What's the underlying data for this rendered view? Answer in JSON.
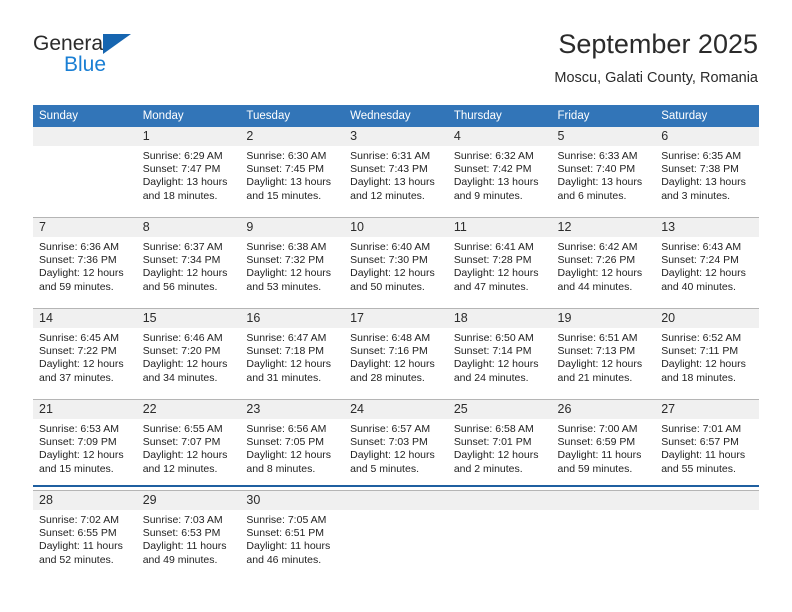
{
  "brand": {
    "name_top": "General",
    "name_bottom": "Blue",
    "accent_dark": "#1665b0",
    "accent_light": "#1a7fd4"
  },
  "header": {
    "title": "September 2025",
    "subtitle": "Moscu, Galati County, Romania"
  },
  "theme": {
    "header_row_bg": "#3275b8",
    "daynum_bg": "#f0f0f0",
    "row_rule": "#b5b5b5",
    "bottom_rule": "#1f5fa0"
  },
  "weekday_headers": [
    "Sunday",
    "Monday",
    "Tuesday",
    "Wednesday",
    "Thursday",
    "Friday",
    "Saturday"
  ],
  "weeks": [
    [
      {
        "day": "",
        "lines": []
      },
      {
        "day": "1",
        "lines": [
          "Sunrise: 6:29 AM",
          "Sunset: 7:47 PM",
          "Daylight: 13 hours",
          "and 18 minutes."
        ]
      },
      {
        "day": "2",
        "lines": [
          "Sunrise: 6:30 AM",
          "Sunset: 7:45 PM",
          "Daylight: 13 hours",
          "and 15 minutes."
        ]
      },
      {
        "day": "3",
        "lines": [
          "Sunrise: 6:31 AM",
          "Sunset: 7:43 PM",
          "Daylight: 13 hours",
          "and 12 minutes."
        ]
      },
      {
        "day": "4",
        "lines": [
          "Sunrise: 6:32 AM",
          "Sunset: 7:42 PM",
          "Daylight: 13 hours",
          "and 9 minutes."
        ]
      },
      {
        "day": "5",
        "lines": [
          "Sunrise: 6:33 AM",
          "Sunset: 7:40 PM",
          "Daylight: 13 hours",
          "and 6 minutes."
        ]
      },
      {
        "day": "6",
        "lines": [
          "Sunrise: 6:35 AM",
          "Sunset: 7:38 PM",
          "Daylight: 13 hours",
          "and 3 minutes."
        ]
      }
    ],
    [
      {
        "day": "7",
        "lines": [
          "Sunrise: 6:36 AM",
          "Sunset: 7:36 PM",
          "Daylight: 12 hours",
          "and 59 minutes."
        ]
      },
      {
        "day": "8",
        "lines": [
          "Sunrise: 6:37 AM",
          "Sunset: 7:34 PM",
          "Daylight: 12 hours",
          "and 56 minutes."
        ]
      },
      {
        "day": "9",
        "lines": [
          "Sunrise: 6:38 AM",
          "Sunset: 7:32 PM",
          "Daylight: 12 hours",
          "and 53 minutes."
        ]
      },
      {
        "day": "10",
        "lines": [
          "Sunrise: 6:40 AM",
          "Sunset: 7:30 PM",
          "Daylight: 12 hours",
          "and 50 minutes."
        ]
      },
      {
        "day": "11",
        "lines": [
          "Sunrise: 6:41 AM",
          "Sunset: 7:28 PM",
          "Daylight: 12 hours",
          "and 47 minutes."
        ]
      },
      {
        "day": "12",
        "lines": [
          "Sunrise: 6:42 AM",
          "Sunset: 7:26 PM",
          "Daylight: 12 hours",
          "and 44 minutes."
        ]
      },
      {
        "day": "13",
        "lines": [
          "Sunrise: 6:43 AM",
          "Sunset: 7:24 PM",
          "Daylight: 12 hours",
          "and 40 minutes."
        ]
      }
    ],
    [
      {
        "day": "14",
        "lines": [
          "Sunrise: 6:45 AM",
          "Sunset: 7:22 PM",
          "Daylight: 12 hours",
          "and 37 minutes."
        ]
      },
      {
        "day": "15",
        "lines": [
          "Sunrise: 6:46 AM",
          "Sunset: 7:20 PM",
          "Daylight: 12 hours",
          "and 34 minutes."
        ]
      },
      {
        "day": "16",
        "lines": [
          "Sunrise: 6:47 AM",
          "Sunset: 7:18 PM",
          "Daylight: 12 hours",
          "and 31 minutes."
        ]
      },
      {
        "day": "17",
        "lines": [
          "Sunrise: 6:48 AM",
          "Sunset: 7:16 PM",
          "Daylight: 12 hours",
          "and 28 minutes."
        ]
      },
      {
        "day": "18",
        "lines": [
          "Sunrise: 6:50 AM",
          "Sunset: 7:14 PM",
          "Daylight: 12 hours",
          "and 24 minutes."
        ]
      },
      {
        "day": "19",
        "lines": [
          "Sunrise: 6:51 AM",
          "Sunset: 7:13 PM",
          "Daylight: 12 hours",
          "and 21 minutes."
        ]
      },
      {
        "day": "20",
        "lines": [
          "Sunrise: 6:52 AM",
          "Sunset: 7:11 PM",
          "Daylight: 12 hours",
          "and 18 minutes."
        ]
      }
    ],
    [
      {
        "day": "21",
        "lines": [
          "Sunrise: 6:53 AM",
          "Sunset: 7:09 PM",
          "Daylight: 12 hours",
          "and 15 minutes."
        ]
      },
      {
        "day": "22",
        "lines": [
          "Sunrise: 6:55 AM",
          "Sunset: 7:07 PM",
          "Daylight: 12 hours",
          "and 12 minutes."
        ]
      },
      {
        "day": "23",
        "lines": [
          "Sunrise: 6:56 AM",
          "Sunset: 7:05 PM",
          "Daylight: 12 hours",
          "and 8 minutes."
        ]
      },
      {
        "day": "24",
        "lines": [
          "Sunrise: 6:57 AM",
          "Sunset: 7:03 PM",
          "Daylight: 12 hours",
          "and 5 minutes."
        ]
      },
      {
        "day": "25",
        "lines": [
          "Sunrise: 6:58 AM",
          "Sunset: 7:01 PM",
          "Daylight: 12 hours",
          "and 2 minutes."
        ]
      },
      {
        "day": "26",
        "lines": [
          "Sunrise: 7:00 AM",
          "Sunset: 6:59 PM",
          "Daylight: 11 hours",
          "and 59 minutes."
        ]
      },
      {
        "day": "27",
        "lines": [
          "Sunrise: 7:01 AM",
          "Sunset: 6:57 PM",
          "Daylight: 11 hours",
          "and 55 minutes."
        ]
      }
    ],
    [
      {
        "day": "28",
        "lines": [
          "Sunrise: 7:02 AM",
          "Sunset: 6:55 PM",
          "Daylight: 11 hours",
          "and 52 minutes."
        ]
      },
      {
        "day": "29",
        "lines": [
          "Sunrise: 7:03 AM",
          "Sunset: 6:53 PM",
          "Daylight: 11 hours",
          "and 49 minutes."
        ]
      },
      {
        "day": "30",
        "lines": [
          "Sunrise: 7:05 AM",
          "Sunset: 6:51 PM",
          "Daylight: 11 hours",
          "and 46 minutes."
        ]
      },
      {
        "day": "",
        "lines": []
      },
      {
        "day": "",
        "lines": []
      },
      {
        "day": "",
        "lines": []
      },
      {
        "day": "",
        "lines": []
      }
    ]
  ]
}
